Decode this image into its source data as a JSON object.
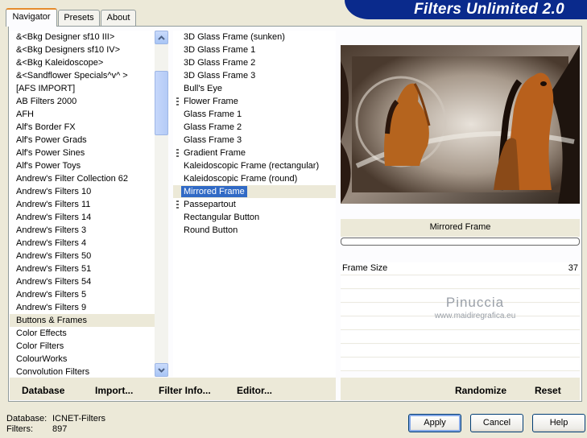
{
  "window": {
    "title": "Filters Unlimited 2.0"
  },
  "tabs": [
    {
      "label": "Navigator",
      "active": true
    },
    {
      "label": "Presets",
      "active": false
    },
    {
      "label": "About",
      "active": false
    }
  ],
  "categories": [
    "&<Bkg Designer sf10 III>",
    "&<Bkg Designers sf10 IV>",
    "&<Bkg Kaleidoscope>",
    "&<Sandflower Specials^v^ >",
    "[AFS IMPORT]",
    "AB Filters 2000",
    "AFH",
    "Alf's Border FX",
    "Alf's Power Grads",
    "Alf's Power Sines",
    "Alf's Power Toys",
    "Andrew's Filter Collection 62",
    "Andrew's Filters 10",
    "Andrew's Filters 11",
    "Andrew's Filters 14",
    "Andrew's Filters 3",
    "Andrew's Filters 4",
    "Andrew's Filters 50",
    "Andrew's Filters 51",
    "Andrew's Filters 54",
    "Andrew's Filters 5",
    "Andrew's Filters 9",
    "Buttons & Frames",
    "Color Effects",
    "Color Filters",
    "ColourWorks",
    "Convolution Filters"
  ],
  "selected_category": "Buttons & Frames",
  "filters": [
    {
      "label": "3D Glass Frame (sunken)",
      "grip": false
    },
    {
      "label": "3D Glass Frame 1",
      "grip": false
    },
    {
      "label": "3D Glass Frame 2",
      "grip": false
    },
    {
      "label": "3D Glass Frame 3",
      "grip": false
    },
    {
      "label": "Bull's Eye",
      "grip": false
    },
    {
      "label": "Flower Frame",
      "grip": true
    },
    {
      "label": "Glass Frame 1",
      "grip": false
    },
    {
      "label": "Glass Frame 2",
      "grip": false
    },
    {
      "label": "Glass Frame 3",
      "grip": false
    },
    {
      "label": "Gradient Frame",
      "grip": true
    },
    {
      "label": "Kaleidoscopic Frame (rectangular)",
      "grip": false
    },
    {
      "label": "Kaleidoscopic Frame (round)",
      "grip": false
    },
    {
      "label": "Mirrored Frame",
      "grip": false
    },
    {
      "label": "Passepartout",
      "grip": true
    },
    {
      "label": "Rectangular Button",
      "grip": false
    },
    {
      "label": "Round Button",
      "grip": false
    }
  ],
  "selected_filter": "Mirrored Frame",
  "preview": {
    "filter_name": "Mirrored Frame",
    "watermark": "Pinuccia",
    "watermark_url": "www.maidiregrafica.eu"
  },
  "params": [
    {
      "label": "Frame Size",
      "value": "37"
    }
  ],
  "toolbar": {
    "database": "Database",
    "import": "Import...",
    "filter_info": "Filter Info...",
    "editor": "Editor...",
    "randomize": "Randomize",
    "reset": "Reset"
  },
  "status": {
    "database_label": "Database:",
    "database_value": "ICNET-Filters",
    "filters_label": "Filters:",
    "filters_value": "897"
  },
  "buttons": {
    "apply": "Apply",
    "cancel": "Cancel",
    "help": "Help"
  },
  "colors": {
    "banner": "#0a2a8c",
    "selection": "#316ac5",
    "tab_accent": "#e68b2c"
  }
}
